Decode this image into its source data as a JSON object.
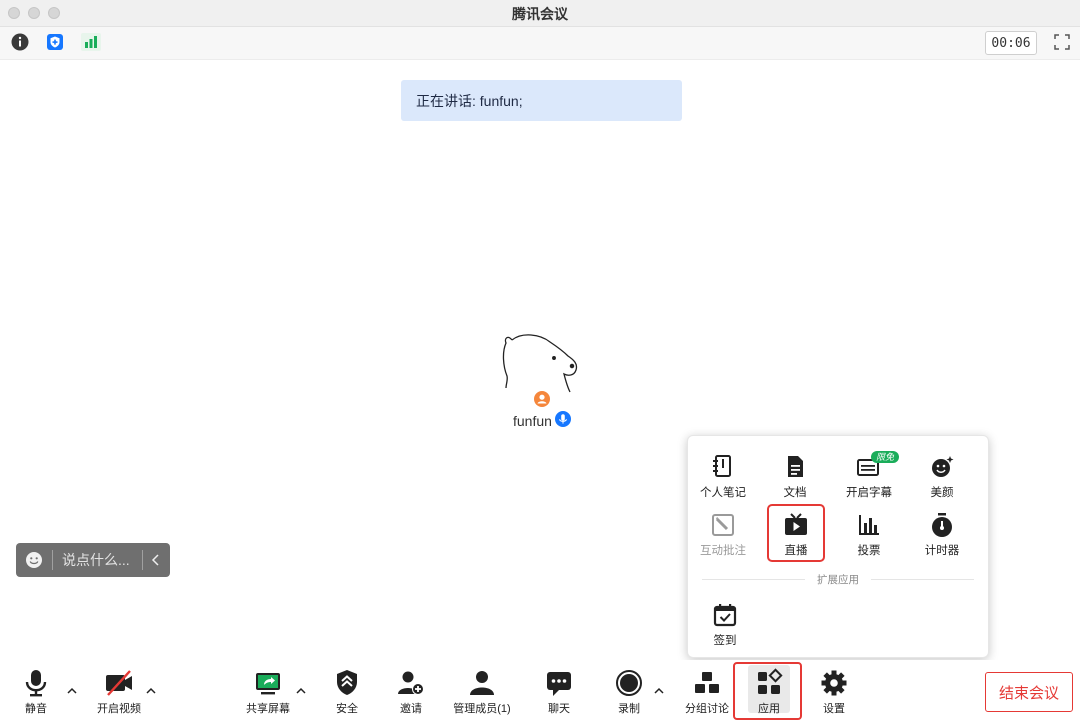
{
  "window": {
    "title": "腾讯会议"
  },
  "info_bar": {
    "timer": "00:06"
  },
  "speaking": {
    "text": "正在讲话: funfun;"
  },
  "participant": {
    "name": "funfun"
  },
  "chat": {
    "placeholder": "说点什么..."
  },
  "apps_popup": {
    "items": [
      {
        "label": "个人笔记",
        "icon": "notebook-icon"
      },
      {
        "label": "文档",
        "icon": "document-icon"
      },
      {
        "label": "开启字幕",
        "icon": "caption-icon",
        "badge": "限免"
      },
      {
        "label": "美颜",
        "icon": "beauty-icon"
      },
      {
        "label": "互动批注",
        "icon": "annotation-icon",
        "disabled": true
      },
      {
        "label": "直播",
        "icon": "live-stream-icon",
        "highlighted": true
      },
      {
        "label": "投票",
        "icon": "vote-icon"
      },
      {
        "label": "计时器",
        "icon": "stopwatch-icon"
      }
    ],
    "section_label": "扩展应用",
    "extensions": [
      {
        "label": "签到",
        "icon": "checkin-icon"
      }
    ]
  },
  "toolbar": {
    "mute": "静音",
    "video": "开启视频",
    "share": "共享屏幕",
    "security": "安全",
    "invite": "邀请",
    "members": "管理成员(1)",
    "chat": "聊天",
    "record": "录制",
    "breakout": "分组讨论",
    "apps": "应用",
    "settings": "设置",
    "end": "结束会议"
  },
  "colors": {
    "accent": "#1677ff",
    "danger": "#e53935",
    "badge": "#1aad5a",
    "speaking_bg": "#dbe8fb"
  }
}
